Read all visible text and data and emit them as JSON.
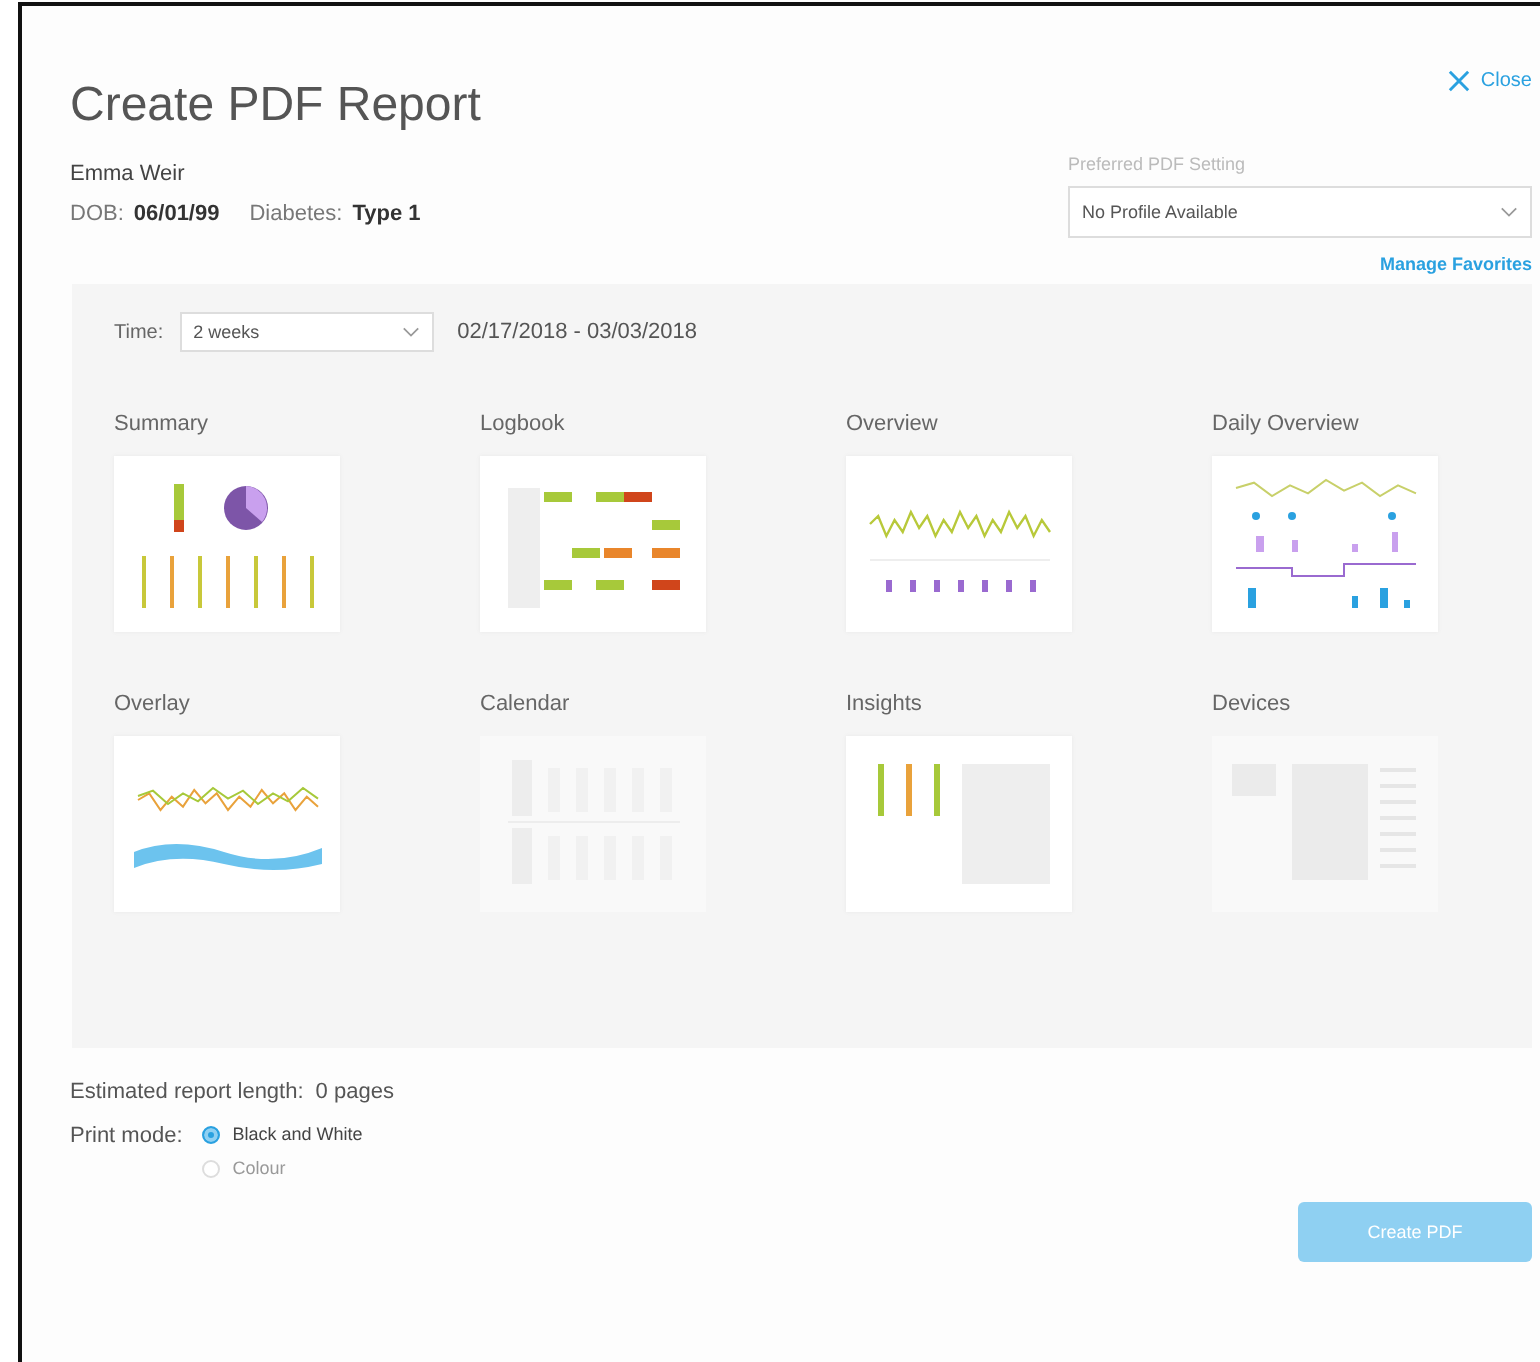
{
  "dialog": {
    "title": "Create PDF Report",
    "close_label": "Close"
  },
  "patient": {
    "name": "Emma Weir",
    "dob_label": "DOB:",
    "dob": "06/01/99",
    "diabetes_label": "Diabetes:",
    "diabetes": "Type 1"
  },
  "pdf_setting": {
    "label": "Preferred PDF Setting",
    "value": "No Profile Available",
    "manage_link": "Manage Favorites"
  },
  "time": {
    "label": "Time:",
    "value": "2 weeks",
    "range": "02/17/2018 - 03/03/2018"
  },
  "reports": [
    {
      "label": "Summary",
      "kind": "summary",
      "disabled": false
    },
    {
      "label": "Logbook",
      "kind": "logbook",
      "disabled": false
    },
    {
      "label": "Overview",
      "kind": "overview",
      "disabled": false
    },
    {
      "label": "Daily Overview",
      "kind": "daily",
      "disabled": false
    },
    {
      "label": "Overlay",
      "kind": "overlay",
      "disabled": false
    },
    {
      "label": "Calendar",
      "kind": "calendar",
      "disabled": true
    },
    {
      "label": "Insights",
      "kind": "insights",
      "disabled": false
    },
    {
      "label": "Devices",
      "kind": "devices",
      "disabled": true
    }
  ],
  "estimate": {
    "label": "Estimated report length:",
    "value": "0 pages"
  },
  "print_mode": {
    "label": "Print mode:",
    "options": [
      {
        "label": "Black and White",
        "selected": true
      },
      {
        "label": "Colour",
        "selected": false
      }
    ]
  },
  "create_button": {
    "label": "Create PDF",
    "disabled": true
  }
}
